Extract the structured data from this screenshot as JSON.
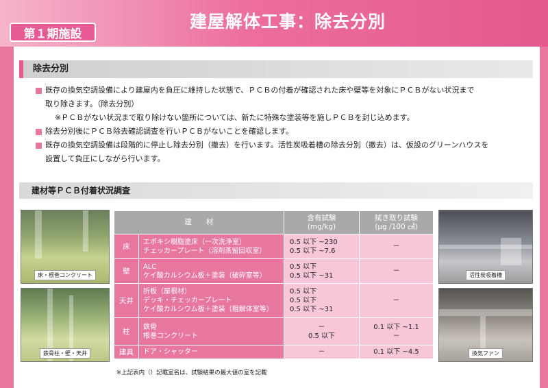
{
  "header": {
    "phase": "第１期施設",
    "title": "建屋解体工事：除去分別"
  },
  "section1": {
    "title": "除去分別",
    "bullets": [
      {
        "lines": [
          "既存の換気空調設備により建屋内を負圧に維持した状態で、ＰＣＢの付着が確認された床や壁等を対象にＰＣＢがない状況まで",
          "取り除きます。（除去分別）"
        ],
        "note": "※ＰＣＢがない状況まで取り除けない箇所については、新たに特殊な塗装等を施しＰＣＢを封じ込めます。"
      },
      {
        "lines": [
          "除去分別後にＰＣＢ除去確認調査を行いＰＣＢがないことを確認します。"
        ]
      },
      {
        "lines": [
          "既存の換気空調設備は段階的に停止し除去分別（撤去）を行います。活性炭吸着槽の除去分別（撤去）は、仮設のグリーンハウスを",
          "設置して負圧にしながら行います。"
        ]
      }
    ]
  },
  "section2": {
    "title": "建材等ＰＣＢ付着状況調査"
  },
  "photos": {
    "p1": "床・根巻コンクリート",
    "p2": "鉄骨柱・壁・天井",
    "p3": "活性炭吸着槽",
    "p4": "換気ファン"
  },
  "table": {
    "headers": {
      "material": "建　　材",
      "content_test_1": "含有試験",
      "content_test_2": "(mg/kg)",
      "wipe_test_1": "拭き取り試験",
      "wipe_test_2": "(μg /100 ㎠)"
    },
    "rows": [
      {
        "category": "床",
        "materials": [
          "エポキシ樹脂塗床（一次洗浄室）",
          "チェッカープレート（溶剤蒸留回収室）"
        ],
        "content": [
          "0.5 以下 ~230",
          "0.5 以下 ~7.6"
        ],
        "wipe": [
          "－"
        ]
      },
      {
        "category": "壁",
        "materials": [
          "ALC",
          "ケイ酸カルシウム板＋塗装（破砕室等）"
        ],
        "content": [
          "0.5 以下",
          "0.5 以下 ~31"
        ],
        "wipe": [
          "－"
        ]
      },
      {
        "category": "天井",
        "materials": [
          "折板（屋根材）",
          "デッキ・チェッカープレート",
          "ケイ酸カルシウム板＋塗装（粗解体室等）"
        ],
        "content": [
          "0.5 以下",
          "0.5 以下",
          "0.5 以下 ~31"
        ],
        "wipe": [
          "－"
        ]
      },
      {
        "category": "柱",
        "materials": [
          "鉄骨",
          "根巻コンクリート"
        ],
        "content": [
          "－",
          "0.5 以下"
        ],
        "wipe": [
          "0.1 以下 ~1.1",
          "－"
        ]
      },
      {
        "category": "建具",
        "materials": [
          "ドア・シャッター"
        ],
        "content": [
          "－"
        ],
        "wipe": [
          "0.1 以下 ~4.5"
        ]
      }
    ]
  },
  "footnote": "※上記表内（）記載室名は、試験結果の最大値の室を記載",
  "colors": {
    "accent": "#e85a93",
    "row_dark": "#e8779f",
    "row_light": "#f7c6d8",
    "header_gray": "#a9a9a9"
  }
}
